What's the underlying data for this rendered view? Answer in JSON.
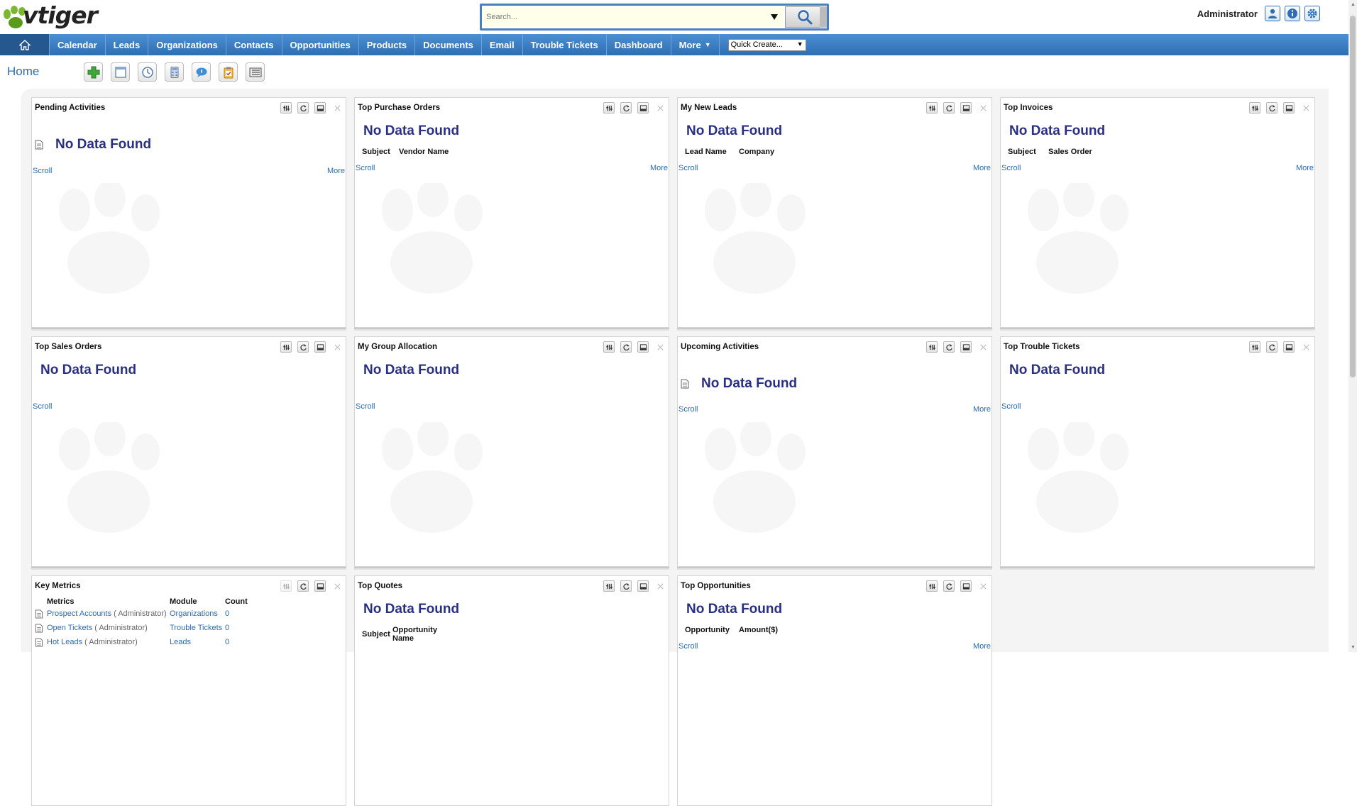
{
  "brand": {
    "logo_text": "vtiger"
  },
  "search": {
    "placeholder": "Search..."
  },
  "user": {
    "name": "Administrator"
  },
  "nav": {
    "items": [
      "Calendar",
      "Leads",
      "Organizations",
      "Contacts",
      "Opportunities",
      "Products",
      "Documents",
      "Email",
      "Trouble Tickets",
      "Dashboard"
    ],
    "more_label": "More",
    "quick_create": "Quick Create..."
  },
  "page": {
    "title": "Home"
  },
  "common": {
    "no_data": "No Data Found",
    "scroll": "Scroll",
    "more": "More"
  },
  "widgets": {
    "pending_activities": {
      "title": "Pending Activities"
    },
    "top_purchase_orders": {
      "title": "Top Purchase Orders",
      "cols": [
        "Subject",
        "Vendor Name"
      ]
    },
    "my_new_leads": {
      "title": "My New Leads",
      "cols": [
        "Lead Name",
        "Company"
      ]
    },
    "top_invoices": {
      "title": "Top Invoices",
      "cols": [
        "Subject",
        "Sales Order"
      ]
    },
    "top_sales_orders": {
      "title": "Top Sales Orders"
    },
    "my_group_allocation": {
      "title": "My Group Allocation"
    },
    "upcoming_activities": {
      "title": "Upcoming Activities"
    },
    "top_trouble_tickets": {
      "title": "Top Trouble Tickets"
    },
    "key_metrics": {
      "title": "Key Metrics",
      "cols": [
        "Metrics",
        "Module",
        "Count"
      ],
      "rows": [
        {
          "metric": "Prospect Accounts",
          "owner": "( Administrator)",
          "module": "Organizations",
          "count": "0"
        },
        {
          "metric": "Open Tickets",
          "owner": "( Administrator)",
          "module": "Trouble Tickets",
          "count": "0"
        },
        {
          "metric": "Hot Leads",
          "owner": "( Administrator)",
          "module": "Leads",
          "count": "0"
        }
      ]
    },
    "top_quotes": {
      "title": "Top Quotes",
      "cols": [
        "Subject",
        "Opportunity Name"
      ]
    },
    "top_opportunities": {
      "title": "Top Opportunities",
      "cols": [
        "Opportunity",
        "Amount($)"
      ]
    }
  }
}
